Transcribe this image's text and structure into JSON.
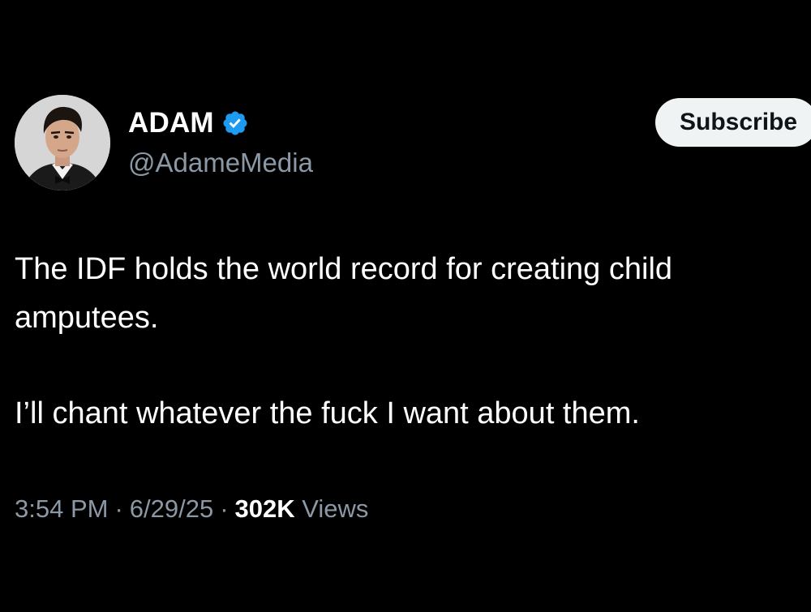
{
  "author": {
    "display_name": "ADAM",
    "handle": "@AdameMedia",
    "verified_icon": "verified-badge-icon",
    "avatar_icon": "profile-photo"
  },
  "actions": {
    "subscribe_label": "Subscribe"
  },
  "tweet": {
    "paragraphs": [
      "The IDF holds the world record for creating child amputees.",
      "I’ll chant whatever the fuck I want about them."
    ]
  },
  "meta": {
    "time": "3:54 PM",
    "date": "6/29/25",
    "separator": "·",
    "views_count": "302K",
    "views_label": "Views"
  },
  "colors": {
    "background": "#000000",
    "text_primary": "#ffffff",
    "text_secondary": "#8b98a5",
    "verified_blue": "#1d9bf0",
    "button_bg": "#eff3f4"
  }
}
